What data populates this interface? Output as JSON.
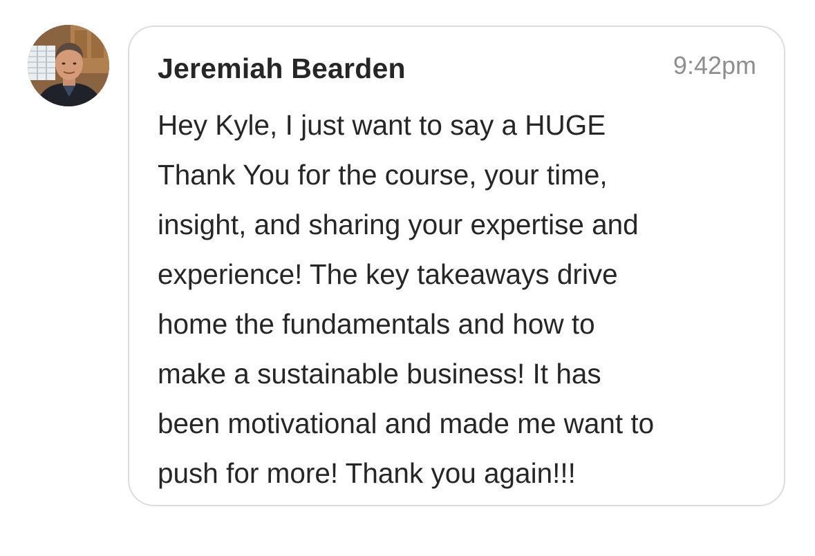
{
  "sender": {
    "name": "Jeremiah Bearden",
    "avatar_icon": "profile-photo"
  },
  "message": {
    "time": "9:42pm",
    "lines": [
      "Hey Kyle, I just want to say a HUGE",
      "Thank You for the course, your time,",
      "insight, and sharing your expertise and",
      "experience! The key takeaways drive",
      "home the fundamentals and how to",
      "make a sustainable business! It has",
      "been motivational and made me want to",
      "push for more! Thank you again!!!"
    ]
  },
  "colors": {
    "text": "#262626",
    "timestamp": "#8e8e8e",
    "bubble_border": "#dcdcdc",
    "background": "#ffffff"
  }
}
